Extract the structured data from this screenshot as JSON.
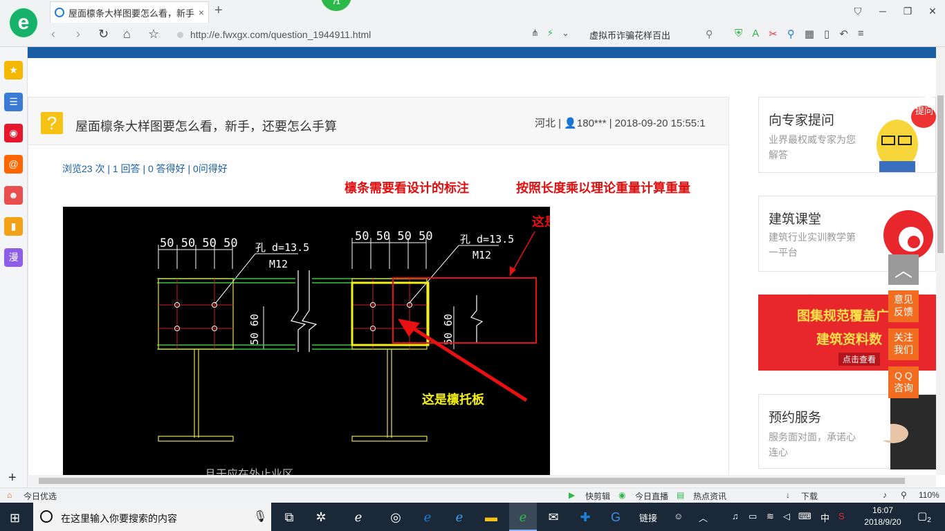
{
  "browser": {
    "tab_title": "屋面檩条大样图要怎么看，新手，",
    "tab_close": "×",
    "new_tab": "+",
    "badge": "71",
    "url": "http://e.fwxgx.com/question_1944911.html",
    "search_text": "虚拟币诈骗花样百出",
    "window_controls": [
      "⛉",
      "─",
      "❐",
      "✕"
    ]
  },
  "sidebar": {
    "icons": [
      {
        "name": "favorites-icon",
        "glyph": "★",
        "color": "#f5b800"
      },
      {
        "name": "news-icon",
        "glyph": "☰",
        "color": "#3a7bd5"
      },
      {
        "name": "weibo-icon",
        "glyph": "◉",
        "color": "#e6162d"
      },
      {
        "name": "mail-icon",
        "glyph": "@",
        "color": "#ff6600"
      },
      {
        "name": "game-icon",
        "glyph": "☻",
        "color": "#e94f4f"
      },
      {
        "name": "book-icon",
        "glyph": "▮",
        "color": "#f3a218"
      },
      {
        "name": "comic-icon",
        "glyph": "漫",
        "color": "#8e5ee8"
      }
    ],
    "add": "+"
  },
  "question": {
    "icon": "?",
    "title": "屋面檩条大样图要怎么看，新手，还要怎么手算",
    "meta": "河北 | 👤180*** | 2018-09-20 15:55:1",
    "stats": "浏览23 次 | 1 回答 | 0 答得好 | 0问得好",
    "note_1": "檩条需要看设计的标注",
    "note_2": "按照长度乘以理论重量计算重量"
  },
  "cad": {
    "dims_left": "50  50  50  50",
    "dims_right": "50  50  50  50",
    "hole_label": "孔 d=13.5",
    "bolt_label": "M12",
    "side_dim": "50  60",
    "label_purlin": "这是檩条",
    "label_bracket": "这是檩托板",
    "bottom_text": "且于应在外止业区"
  },
  "right_column": {
    "card1": {
      "title": "向专家提问",
      "sub": "业界最权威专家为您解答",
      "bubble": "点击提问"
    },
    "card2": {
      "title": "建筑课堂",
      "sub": "建筑行业实训教学第一平台"
    },
    "promo": {
      "line1": "图集规范覆盖广",
      "line2": "建筑资料数",
      "cta": "点击查看"
    },
    "card4": {
      "title": "预约服务",
      "sub": "服务面对面，承诺心连心"
    }
  },
  "float_buttons": {
    "top": "︿",
    "feedback": "意见反馈",
    "follow": "关注我们",
    "qq": "Q Q咨询"
  },
  "statusbar": {
    "left": "今日优选",
    "items": [
      "快剪辑",
      "今日直播",
      "热点资讯",
      "下载"
    ],
    "zoom": "110%"
  },
  "taskbar": {
    "search_placeholder": "在这里输入你要搜索的内容",
    "tray_link": "链接",
    "ime": "中",
    "time": "16:07",
    "date": "2018/9/20",
    "notifications": "2"
  }
}
